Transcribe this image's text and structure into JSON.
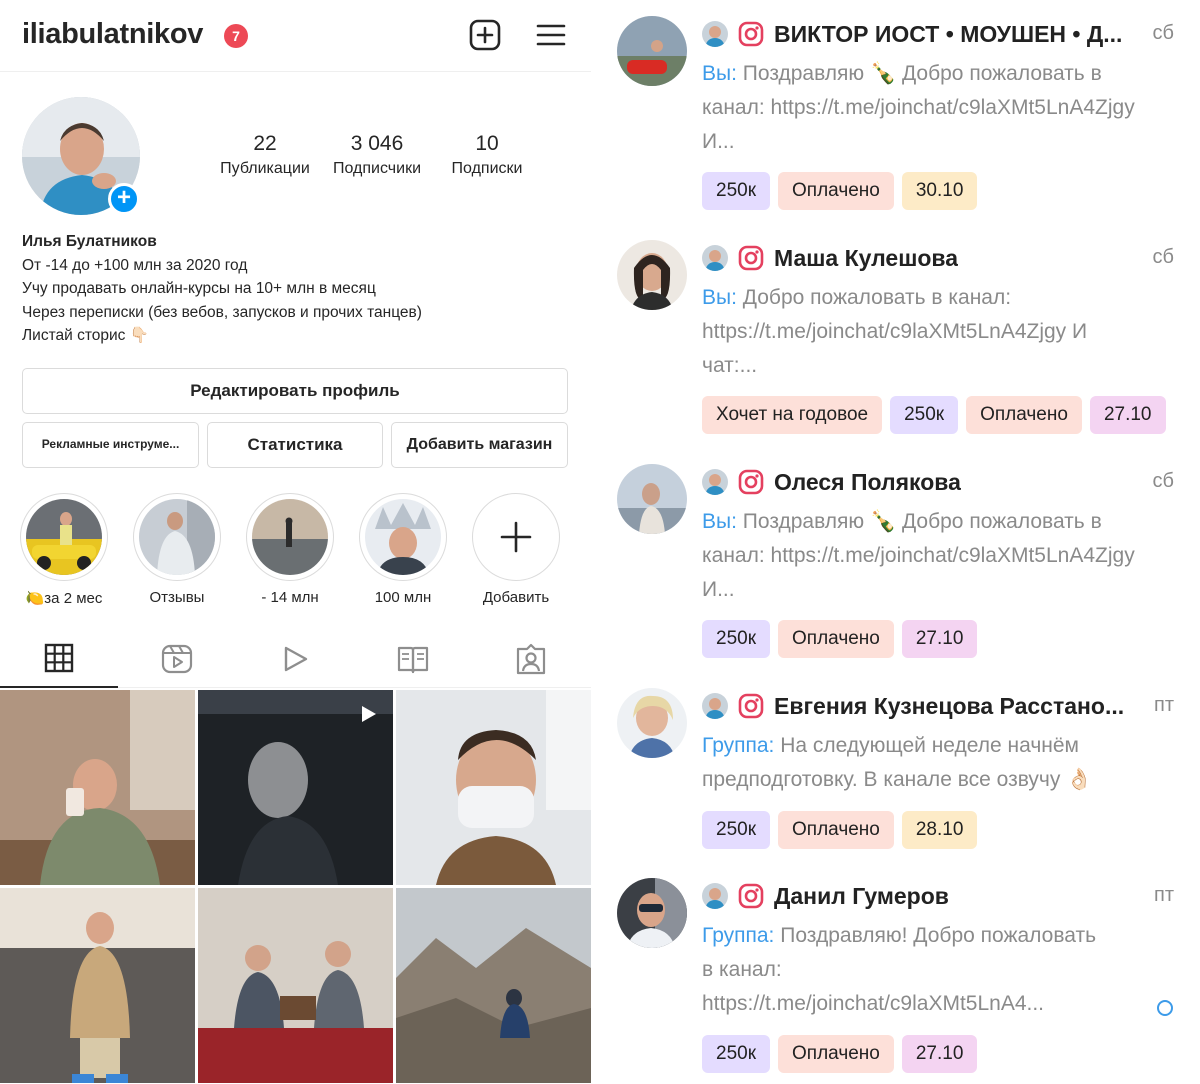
{
  "instagram": {
    "username": "iliabulatnikov",
    "notification_count": "7",
    "stats": [
      {
        "value": "22",
        "label": "Публикации"
      },
      {
        "value": "3 046",
        "label": "Подписчики"
      },
      {
        "value": "10",
        "label": "Подписки"
      }
    ],
    "bio": {
      "name": "Илья Булатников",
      "lines": [
        "От -14 до +100 млн за 2020 год",
        "Учу продавать онлайн-курсы на 10+ млн в месяц",
        "Через переписки (без вебов, запусков и прочих танцев)",
        "Листай сторис 👇🏻"
      ]
    },
    "buttons": {
      "edit_profile": "Редактировать профиль",
      "ad_tools": "Рекламные инструме...",
      "statistics": "Статистика",
      "add_shop": "Добавить магазин"
    },
    "highlights": [
      {
        "label": "🍋за 2 мес"
      },
      {
        "label": "Отзывы"
      },
      {
        "label": "- 14 млн"
      },
      {
        "label": "100 млн"
      },
      {
        "label": "Добавить"
      }
    ],
    "tabs": [
      "grid-icon",
      "reels-icon",
      "video-icon",
      "guides-icon",
      "tagged-icon"
    ]
  },
  "telegram": {
    "chats": [
      {
        "name": "ВИКТОР ИОСТ • МОУШЕН • Д...",
        "day": "сб",
        "sender": "Вы:",
        "message": "Поздравляю 🍾 Добро пожаловать в канал: https://t.me/joinchat/c9laXMt5LnA4Zjgy И...",
        "tags": [
          {
            "text": "250к",
            "color": "#e4dcff"
          },
          {
            "text": "Оплачено",
            "color": "#fde0d9"
          },
          {
            "text": "30.10",
            "color": "#fdebc7"
          }
        ]
      },
      {
        "name": "Маша Кулешова",
        "day": "сб",
        "sender": "Вы:",
        "message": "Добро пожаловать в канал: https://t.me/joinchat/c9laXMt5LnA4Zjgy И чат:...",
        "tags": [
          {
            "text": "Хочет на годовое",
            "color": "#fde0d9"
          },
          {
            "text": "250к",
            "color": "#e4dcff"
          },
          {
            "text": "Оплачено",
            "color": "#fde0d9"
          },
          {
            "text": "27.10",
            "color": "#f4d4f2"
          }
        ]
      },
      {
        "name": "Олеся Полякова",
        "day": "сб",
        "sender": "Вы:",
        "message": "Поздравляю 🍾 Добро пожаловать в канал: https://t.me/joinchat/c9laXMt5LnA4Zjgy И...",
        "tags": [
          {
            "text": "250к",
            "color": "#e4dcff"
          },
          {
            "text": "Оплачено",
            "color": "#fde0d9"
          },
          {
            "text": "27.10",
            "color": "#f4d4f2"
          }
        ]
      },
      {
        "name": "Евгения Кузнецова Расстано...",
        "day": "пт",
        "sender": "Группа:",
        "message": "На следующей неделе начнём предподготовку. В канале все озвучу 👌🏻",
        "tags": [
          {
            "text": "250к",
            "color": "#e4dcff"
          },
          {
            "text": "Оплачено",
            "color": "#fde0d9"
          },
          {
            "text": "28.10",
            "color": "#fdebc7"
          }
        ]
      },
      {
        "name": "Данил Гумеров",
        "day": "пт",
        "sender": "Группа:",
        "message": "Поздравляю! Добро пожаловать в канал: https://t.me/joinchat/c9laXMt5LnA4...",
        "tags": [
          {
            "text": "250к",
            "color": "#e4dcff"
          },
          {
            "text": "Оплачено",
            "color": "#fde0d9"
          },
          {
            "text": "27.10",
            "color": "#f4d4f2"
          }
        ]
      }
    ]
  },
  "colors": {
    "ig_badge": "#ed4956",
    "ig_blue": "#0095f6",
    "tg_sender": "#3d9be9",
    "tg_muted": "#8a8a8a"
  }
}
